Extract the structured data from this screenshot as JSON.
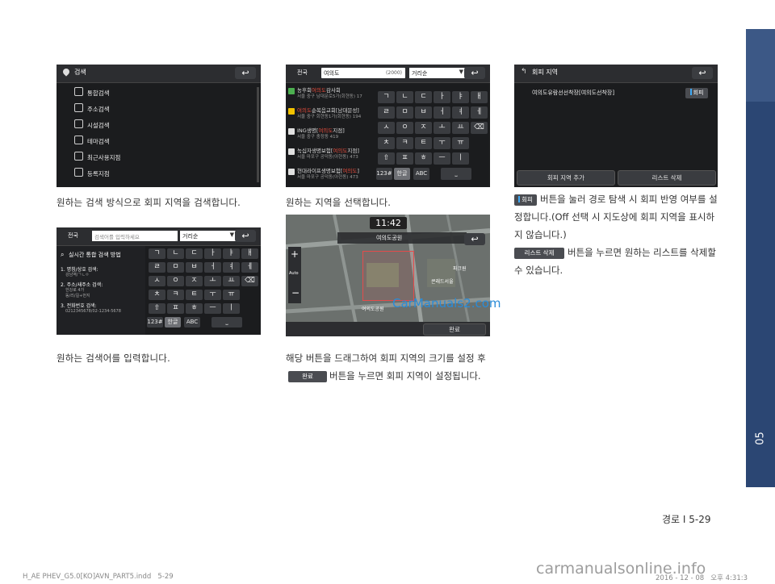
{
  "side_tab": {
    "chapter": "05",
    "color": "#2b4673"
  },
  "footer": {
    "page_label": "경로 I 5-29",
    "file_info": "H_AE PHEV_G5.0[KO]AVN_PART5.indd   5-29",
    "date_info": "2016 - 12 - 08   오후 4:31:3",
    "watermark": "carmanualsonline.info",
    "center_watermark": "CarManuals2.com"
  },
  "panel1": {
    "title": "검색",
    "items": [
      "통합검색",
      "주소검색",
      "시설검색",
      "테마검색",
      "최근사용지점",
      "등록지점"
    ],
    "caption": "원하는 검색 방식으로 회피 지역을 검색합니다."
  },
  "panel2": {
    "region": "전국",
    "query": "여의도",
    "count": "(2000)",
    "sort": "거리순",
    "results": [
      {
        "pre": "농후회",
        "hl": "여의도",
        "post": "감사회",
        "sub": "서울 중구 남대문로5가(회현동) 17"
      },
      {
        "pre": "",
        "hl": "여의도",
        "post": "순복음교회[남대문성]",
        "sub": "서울 중구 회현동1가(회현동) 194"
      },
      {
        "pre": "ING생명[",
        "hl": "여의도",
        "post": "지점]",
        "sub": "서울 중구 충정동 419"
      },
      {
        "pre": "녹십자생명보험[",
        "hl": "여의도",
        "post": "지점]",
        "sub": "서울 마포구 공덕동(아현동) 473"
      },
      {
        "pre": "현대라이프생명보험[",
        "hl": "여의도",
        "post": "]",
        "sub": "서울 마포구 공덕동(아현동) 473"
      }
    ],
    "keys": [
      [
        "ㄱ",
        "ㄴ",
        "ㄷ",
        "ㅏ",
        "ㅑ",
        "ㅐ"
      ],
      [
        "ㄹ",
        "ㅁ",
        "ㅂ",
        "ㅓ",
        "ㅕ",
        "ㅔ"
      ],
      [
        "ㅅ",
        "ㅇ",
        "ㅈ",
        "ㅗ",
        "ㅛ",
        "⌫"
      ],
      [
        "ㅊ",
        "ㅋ",
        "ㅌ",
        "ㅜ",
        "ㅠ",
        ""
      ],
      [
        "⇧",
        "ㅍ",
        "ㅎ",
        "ㅡ",
        "ㅣ",
        ""
      ]
    ],
    "bottom": [
      "123#",
      "한글",
      "ABC",
      "⎵"
    ],
    "caption": "원하는 지역을 선택합니다."
  },
  "panel3": {
    "title": "회피 지역",
    "item": "여의도유람선선착장[여의도선착장]",
    "toggle": "회피",
    "add_btn": "회피 지역 추가",
    "delete_btn": "리스트 삭제",
    "para1_btn": "회피",
    "para1": "버튼을 눌러 경로 탐색 시 회피 반영 여부를 설정합니다.(Off 선택 시 지도상에 회피 지역을 표시하지 않습니다.)",
    "para2_btn": "리스트 삭제",
    "para2": "버튼을 누르면 원하는 리스트를 삭제할 수 있습니다."
  },
  "panel4": {
    "region": "전국",
    "placeholder": "검색어를 입력하세요",
    "sort": "거리순",
    "help_title": "실시간 통합 검색 방법",
    "help": [
      {
        "title": "1. 명칭/상호 검색:",
        "sub": "강남역/ㄱㄴㅇ"
      },
      {
        "title": "2. 주소/새주소 검색:",
        "sub": "한강로 4가\n동/리/길+번지"
      },
      {
        "title": "3. 전화번호 검색:",
        "sub": "0212345678/02-1234-5678"
      }
    ],
    "caption": "원하는 검색어를 입력합니다."
  },
  "panel5": {
    "time": "11:42",
    "place": "여의도공원",
    "auto": "Auto",
    "confirm": "완료",
    "map_labels": [
      "파크원",
      "콘래드서울",
      "여의도공원"
    ],
    "para_pre": "해당 버튼을 드래그하여 회피 지역의 크기를 설정 후",
    "para_btn": "완료",
    "para_post": "버튼을 누르면 회피 지역이 설정됩니다."
  }
}
